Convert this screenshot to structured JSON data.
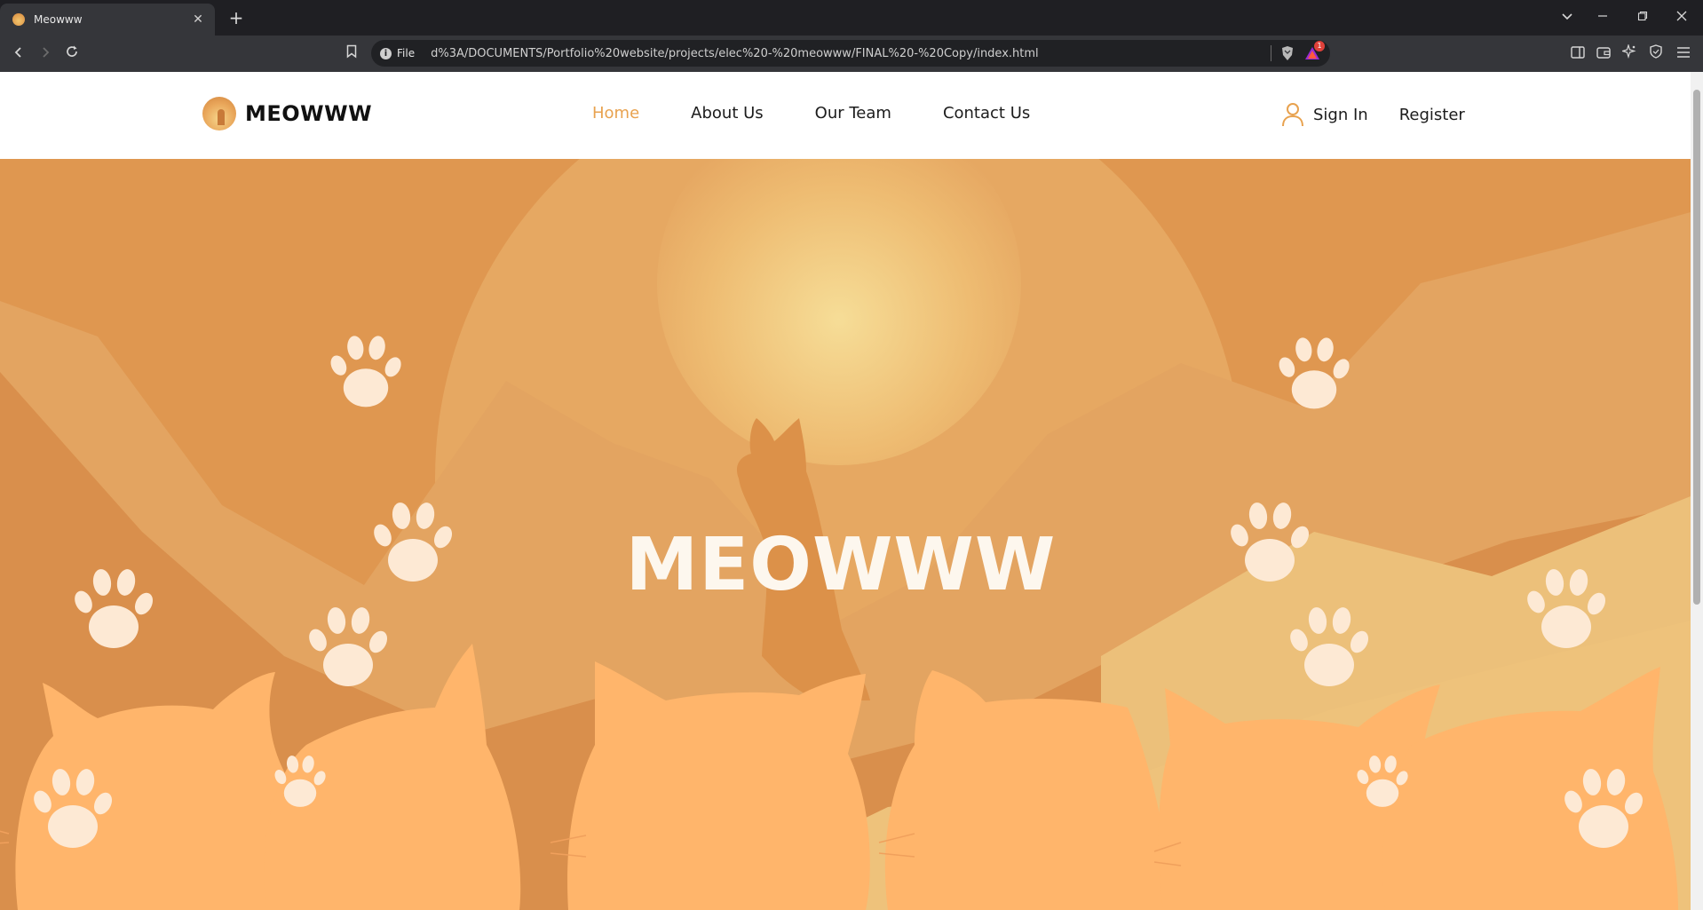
{
  "browser": {
    "tab_title": "Meowww",
    "new_tab_glyph": "+",
    "tab_close_glyph": "✕",
    "address_scheme_label": "File",
    "address_url": "d%3A/DOCUMENTS/Portfolio%20website/projects/elec%20-%20meowww/FINAL%20-%20Copy/index.html",
    "alert_badge_count": "1",
    "icons": [
      "back-icon",
      "forward-icon",
      "reload-icon",
      "bookmark-icon",
      "info-icon",
      "brave-shield-icon",
      "brave-rewards-icon",
      "sidebar-icon",
      "wallet-icon",
      "leo-ai-icon",
      "vpn-icon",
      "menu-icon",
      "tab-list-icon",
      "minimize-icon",
      "restore-icon",
      "close-window-icon"
    ]
  },
  "header": {
    "brand_name": "MEOWWW",
    "nav": [
      {
        "label": "Home",
        "active": true
      },
      {
        "label": "About Us",
        "active": false
      },
      {
        "label": "Our Team",
        "active": false
      },
      {
        "label": "Contact Us",
        "active": false
      }
    ],
    "sign_in_label": "Sign In",
    "register_label": "Register"
  },
  "hero": {
    "title": "MEOWWW"
  },
  "colors": {
    "accent": "#e8a24f",
    "hero_bg": "#e19a55",
    "cat_silhouettes": "#ffb56b",
    "paw_prints": "#fde9d4"
  }
}
